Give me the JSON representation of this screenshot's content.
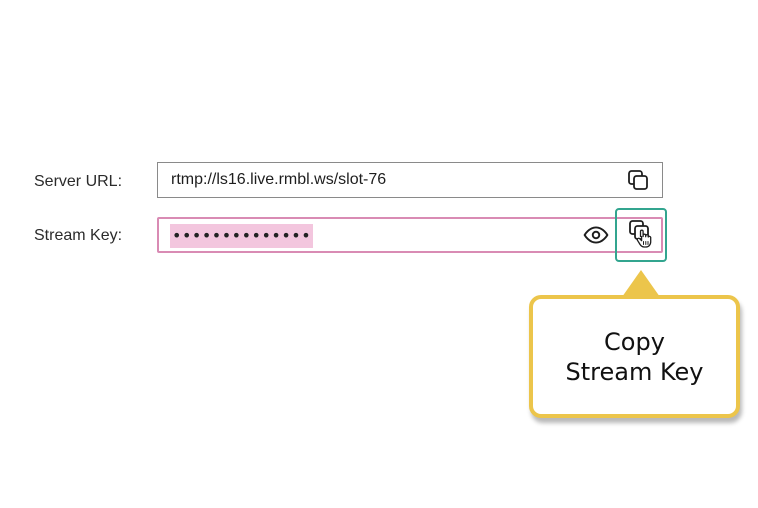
{
  "form": {
    "server_url": {
      "label": "Server URL:",
      "value": "rtmp://ls16.live.rmbl.ws/slot-76",
      "copy_icon": "copy-icon"
    },
    "stream_key": {
      "label": "Stream Key:",
      "masked_value": "••••••••••••••",
      "reveal_icon": "eye-icon",
      "copy_icon": "copy-icon"
    }
  },
  "callout": {
    "text_line1": "Copy",
    "text_line2": "Stream Key"
  },
  "colors": {
    "key_border": "#d98bb4",
    "key_highlight": "#f3c6de",
    "copy_focus_border": "#32a58f",
    "callout_border": "#ecc54b",
    "server_border": "#8a8a8a"
  },
  "cursor_icon": "hand-pointer-icon"
}
